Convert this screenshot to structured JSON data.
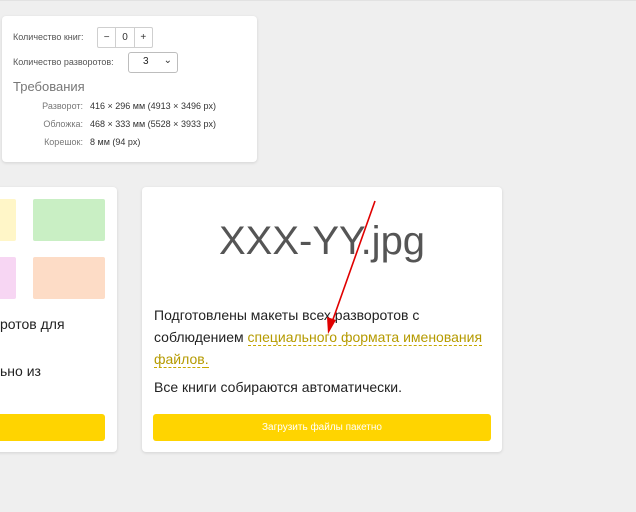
{
  "settings": {
    "books_label": "Количество книг:",
    "minus": "−",
    "books_value": "0",
    "plus": "+",
    "spreads_label": "Количество разворотов:",
    "spreads_value": "3",
    "requirements_title": "Требования",
    "specs": [
      {
        "key": "Разворот:",
        "value": "416 × 296 мм (4913 × 3496 px)"
      },
      {
        "key": "Обложка:",
        "value": "468 × 333 мм (5528 × 3933 px)"
      },
      {
        "key": "Корешок:",
        "value": "8 мм (94 px)"
      }
    ]
  },
  "left_card": {
    "line1": "ротов для",
    "line2": "ьно из",
    "tile_colors": [
      "#fff6c8",
      "#c9efc4",
      "#f7d6f3",
      "#fddcc6"
    ]
  },
  "main_card": {
    "filename": "XXX-YY.jpg",
    "para_before": "Подготовлены макеты всех разворотов с соблюдением ",
    "para_link": "специального формата именования файлов",
    "para_after": ".",
    "para2": "Все книги собираются автоматически.",
    "upload_label": "Загрузить файлы пакетно"
  },
  "colors": {
    "accent": "#ffd400",
    "link": "#b59a00",
    "annotation": "#e00000"
  }
}
